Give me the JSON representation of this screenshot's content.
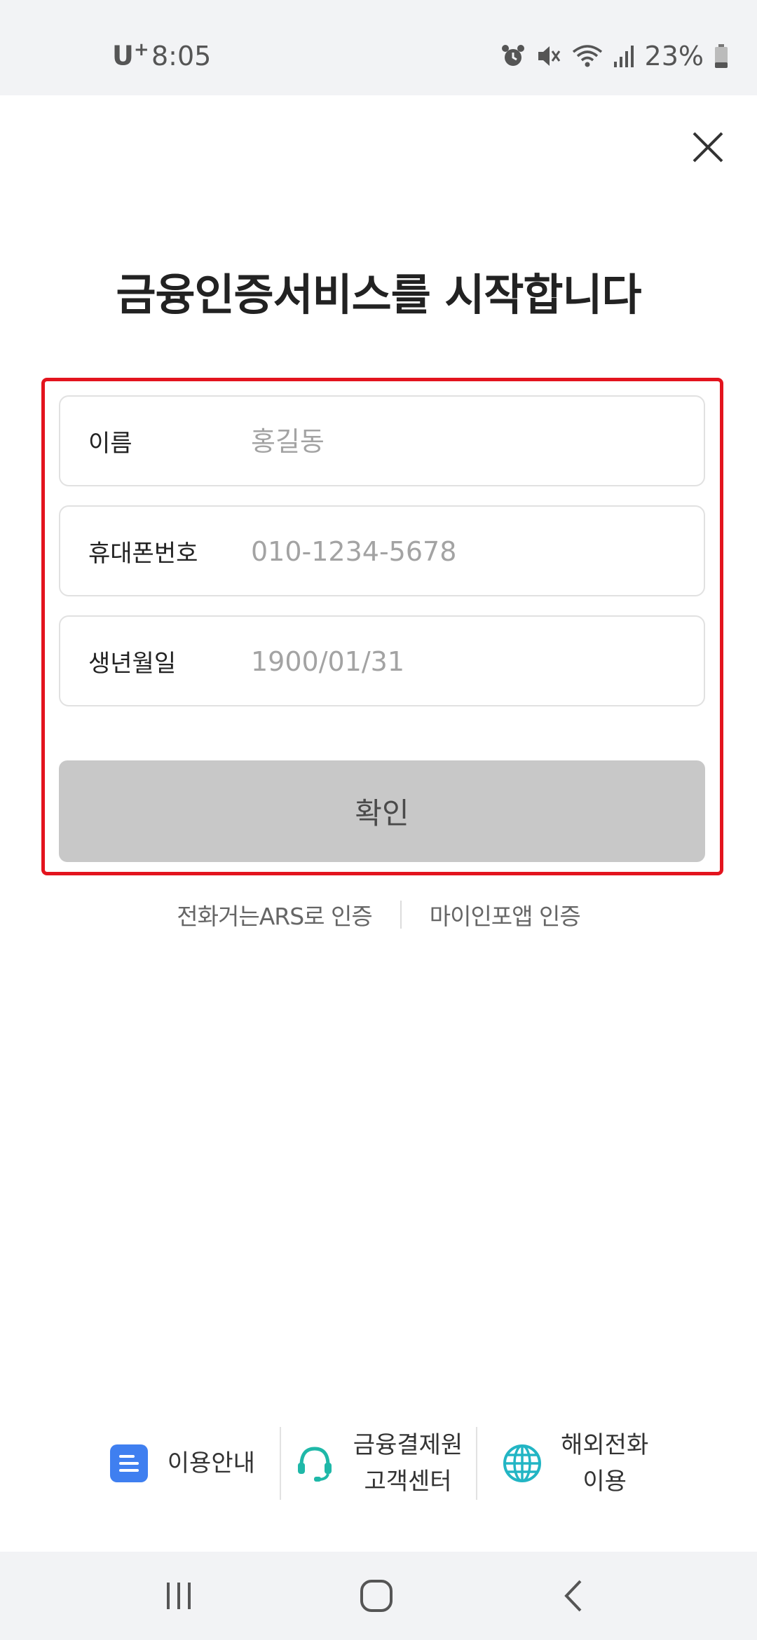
{
  "status_bar": {
    "carrier": "U",
    "carrier_sup": "+",
    "time": "8:05",
    "battery": "23%",
    "icons": [
      "alarm-icon",
      "mute-icon",
      "wifi-icon",
      "signal-icon",
      "battery-icon"
    ]
  },
  "title": "금융인증서비스를 시작합니다",
  "form": {
    "name": {
      "label": "이름",
      "placeholder": "홍길동"
    },
    "phone": {
      "label": "휴대폰번호",
      "placeholder": "010-1234-5678"
    },
    "birth": {
      "label": "생년월일",
      "placeholder": "1900/01/31"
    },
    "confirm_label": "확인",
    "highlight_color": "#e3141e"
  },
  "alt_links": {
    "ars": "전화거는ARS로 인증",
    "myinfo": "마이인포앱 인증"
  },
  "bottom_menu": {
    "guide": "이용안내",
    "support_line1": "금융결제원",
    "support_line2": "고객센터",
    "overseas_line1": "해외전화",
    "overseas_line2": "이용"
  },
  "colors": {
    "button_disabled": "#c8c8c8",
    "guide_icon": "#3f7ff0",
    "support_icon": "#1fb8a8",
    "globe_icon": "#22b5c4"
  }
}
